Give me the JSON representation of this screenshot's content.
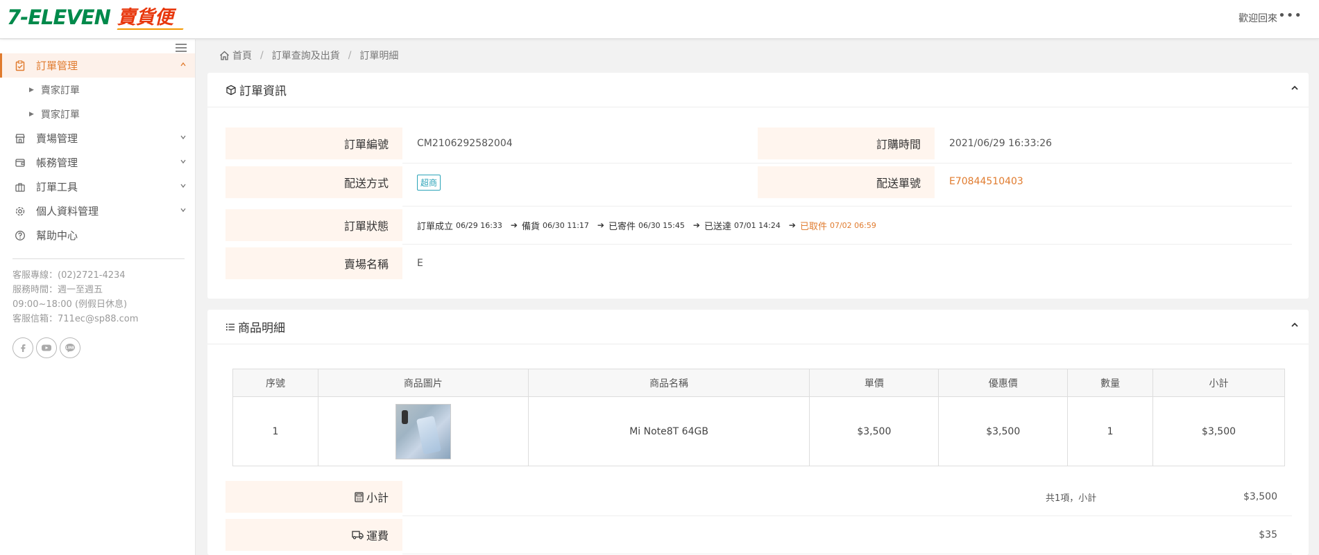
{
  "header": {
    "logo_main": "7-ELEVEN",
    "logo_sub": "賣貨便",
    "welcome": "歡迎回來",
    "more": "•••"
  },
  "sidebar": {
    "menu": [
      {
        "label": "訂單管理",
        "icon": "clipboard-check-icon",
        "active": true,
        "chevron": "^"
      },
      {
        "label": "賣家訂單",
        "sub": true
      },
      {
        "label": "買家訂單",
        "sub": true
      },
      {
        "label": "賣場管理",
        "icon": "store-icon",
        "chevron": "v"
      },
      {
        "label": "帳務管理",
        "icon": "wallet-icon",
        "chevron": "v"
      },
      {
        "label": "訂單工具",
        "icon": "briefcase-icon",
        "chevron": "v"
      },
      {
        "label": "個人資料管理",
        "icon": "gear-icon",
        "chevron": "v"
      },
      {
        "label": "幫助中心",
        "icon": "question-icon"
      }
    ],
    "contact": [
      "客服專線：(02)2721-4234",
      "服務時間：週一至週五",
      "09:00~18:00 (例假日休息)",
      "客服信箱：711ec@sp88.com"
    ],
    "socials": [
      "facebook-icon",
      "youtube-icon",
      "line-icon"
    ]
  },
  "breadcrumb": [
    "首頁",
    "訂單查詢及出貨",
    "訂單明細"
  ],
  "order_info": {
    "title": "訂單資訊",
    "order_no_label": "訂單編號",
    "order_no": "CM2106292582004",
    "order_time_label": "訂購時間",
    "order_time": "2021/06/29 16:33:26",
    "ship_method_label": "配送方式",
    "ship_method": "超商",
    "ship_no_label": "配送單號",
    "ship_no": "E70844510403",
    "status_label": "訂單狀態",
    "status_steps": [
      {
        "name": "訂單成立",
        "time": "06/29 16:33"
      },
      {
        "name": "備貨",
        "time": "06/30 11:17"
      },
      {
        "name": "已寄件",
        "time": "06/30 15:45"
      },
      {
        "name": "已送達",
        "time": "07/01 14:24"
      },
      {
        "name": "已取件",
        "time": "07/02 06:59",
        "highlight": true
      }
    ],
    "store_label": "賣場名稱",
    "store_name": "E"
  },
  "product_detail": {
    "title": "商品明細",
    "columns": [
      "序號",
      "商品圖片",
      "商品名稱",
      "單價",
      "優惠價",
      "數量",
      "小計"
    ],
    "rows": [
      {
        "no": "1",
        "name": "Mi Note8T 64GB",
        "price": "$3,500",
        "discount": "$3,500",
        "qty": "1",
        "subtotal": "$3,500"
      }
    ],
    "subtotal_label": "小計",
    "subtotal_note": "共1項，小計",
    "subtotal_value": "$3,500",
    "shipping_label": "運費",
    "shipping_value": "$35"
  },
  "colors": {
    "accent": "#e07b2e",
    "label_bg": "#fff5ee",
    "tag": "#2aa3b8",
    "brand_green": "#008a4b",
    "brand_red": "#e8380d"
  }
}
